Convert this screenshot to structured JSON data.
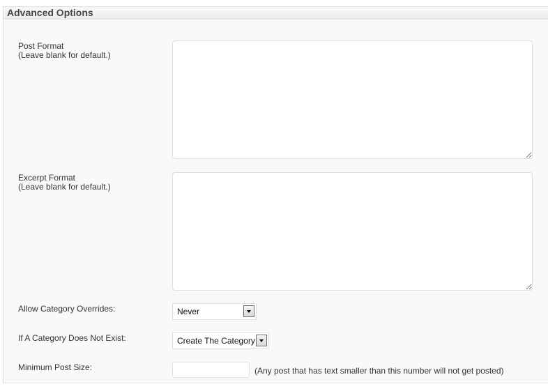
{
  "panel": {
    "title": "Advanced Options"
  },
  "fields": {
    "post_format": {
      "label": "Post Format",
      "note": "(Leave blank for default.)",
      "value": ""
    },
    "excerpt_format": {
      "label": "Excerpt Format",
      "note": "(Leave blank for default.)",
      "value": ""
    },
    "category_overrides": {
      "label": "Allow Category Overrides:",
      "selected": "Never"
    },
    "category_missing": {
      "label": "If A Category Does Not Exist:",
      "selected": "Create The Category"
    },
    "min_post_size": {
      "label": "Minimum Post Size:",
      "value": "",
      "hint": "(Any post that has text smaller than this number will not get posted)"
    }
  }
}
